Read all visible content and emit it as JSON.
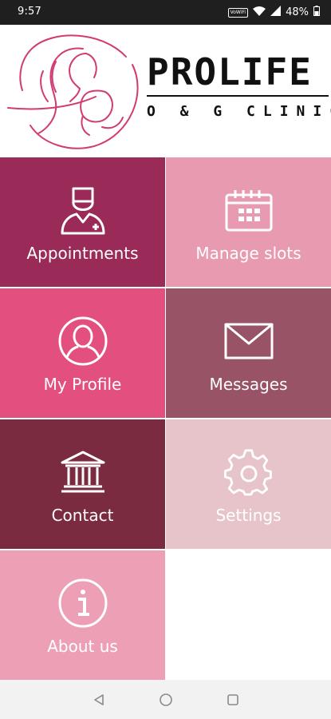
{
  "status_bar": {
    "time": "9:57",
    "network_badge": "VoWiFi",
    "battery": "48%"
  },
  "brand": {
    "name": "PROLIFE",
    "subtitle": "O & G CLINIC",
    "accent_color": "#d23a72"
  },
  "tiles": [
    {
      "label": "Appointments",
      "icon": "doctor-icon",
      "color": "#9a2a57"
    },
    {
      "label": "Manage slots",
      "icon": "calendar-icon",
      "color": "#e89bb0"
    },
    {
      "label": "My Profile",
      "icon": "profile-icon",
      "color": "#e34f7f"
    },
    {
      "label": "Messages",
      "icon": "mail-icon",
      "color": "#995366"
    },
    {
      "label": "Contact",
      "icon": "bank-icon",
      "color": "#7b2b3f"
    },
    {
      "label": "Settings",
      "icon": "gear-icon",
      "color": "#e6c4ca"
    },
    {
      "label": "About us",
      "icon": "info-icon",
      "color": "#eda0b5"
    }
  ],
  "nav": [
    "back-icon",
    "home-icon",
    "recents-icon"
  ]
}
